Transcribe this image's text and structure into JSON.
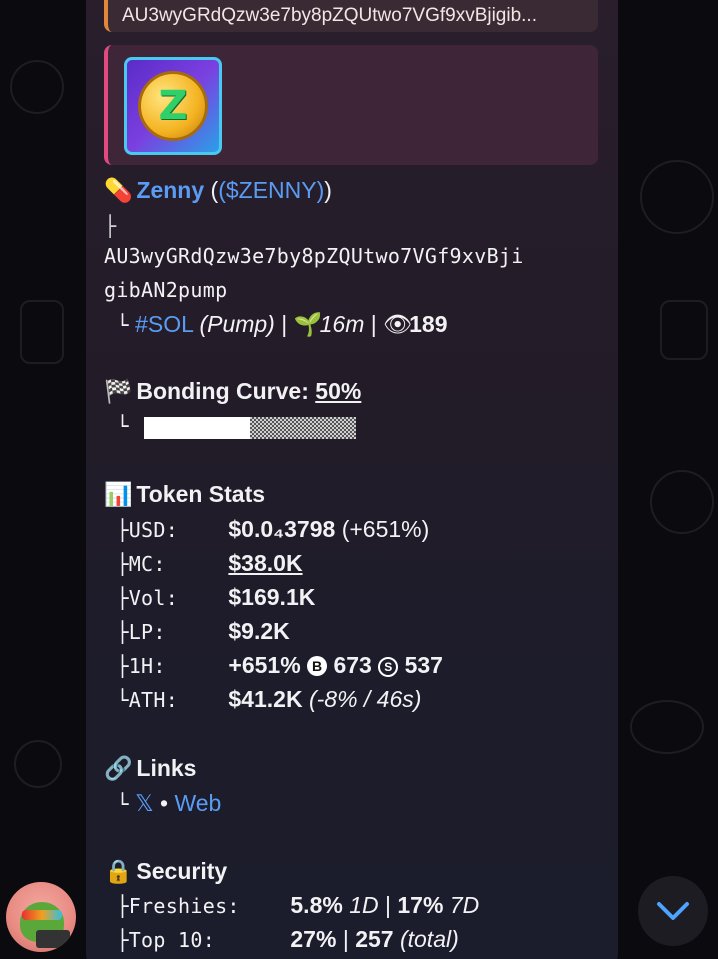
{
  "reply": {
    "text": "AU3wyGRdQzw3e7by8pZQUtwo7VGf9xvBjigib..."
  },
  "token": {
    "emoji": "💊",
    "name": "Zenny",
    "symbol": "($ZENNY)",
    "address_line1": "AU3wyGRdQzw3e7by8pZQUtwo7VGf9xvBji",
    "address_line2": "gibAN2pump",
    "chain": "#SOL",
    "platform": "(Pump)",
    "age": "16m",
    "views": "189"
  },
  "bonding": {
    "title": "Bonding Curve:",
    "percent_label": "50%",
    "progress": 0.5
  },
  "stats": {
    "title": "Token Stats",
    "usd_label": "USD:",
    "usd_value": "$0.0₄3798",
    "usd_change": "(+651%)",
    "mc_label": "MC:",
    "mc_value": "$38.0K",
    "vol_label": "Vol:",
    "vol_value": "$169.1K",
    "lp_label": "LP:",
    "lp_value": "$9.2K",
    "h1_label": "1H:",
    "h1_change": "+651%",
    "h1_buys": "673",
    "h1_sells": "537",
    "ath_label": "ATH:",
    "ath_value": "$41.2K",
    "ath_detail": "(-8% / 46s)"
  },
  "links": {
    "title": "Links",
    "x": "𝕏",
    "sep": "•",
    "web": "Web"
  },
  "security": {
    "title": "Security",
    "freshies_label": "Freshies:",
    "freshies_1d": "5.8%",
    "freshies_1d_unit": "1D",
    "freshies_7d": "17%",
    "freshies_7d_unit": "7D",
    "top10_label": "Top 10:",
    "top10_pct": "27%",
    "top10_total": "257",
    "top10_total_unit": "(total)"
  },
  "colors": {
    "link_blue": "#5a9cf4",
    "reply_accent": "#e0873a",
    "preview_accent": "#e04a80"
  }
}
